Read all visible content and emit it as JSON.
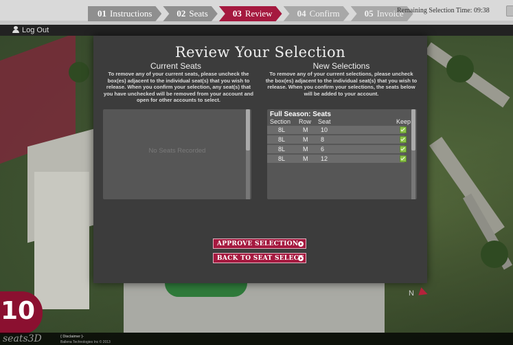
{
  "steps": [
    {
      "num": "01",
      "label": "Instructions",
      "state": "done"
    },
    {
      "num": "02",
      "label": "Seats",
      "state": "done"
    },
    {
      "num": "03",
      "label": "Review",
      "state": "active"
    },
    {
      "num": "04",
      "label": "Confirm",
      "state": "todo"
    },
    {
      "num": "05",
      "label": "Invoice",
      "state": "todo"
    }
  ],
  "timer": "Remaining Selection Time: 09:38",
  "logout": "Log Out",
  "panel": {
    "title": "Review Your Selection",
    "current": {
      "heading": "Current Seats",
      "instructions": "To remove any of your current seats, please uncheck the box(es) adjacent to the individual seat(s) that you wish to release. When you confirm your selection, any seat(s) that you have unchecked will be removed from your account and open for other accounts to select.",
      "empty": "No Seats Recorded"
    },
    "new": {
      "heading": "New Selections",
      "instructions": "To remove any of your current selections, please uncheck the box(es) adjacent to the individual seat(s) that you wish to release. When you confirm your selections, the seats below will be added to your account.",
      "group": "Full Season: Seats",
      "columns": [
        "Section",
        "Row",
        "Seat",
        "Keep"
      ],
      "rows": [
        {
          "section": "8L",
          "row": "M",
          "seat": "10",
          "keep": true
        },
        {
          "section": "8L",
          "row": "M",
          "seat": "8",
          "keep": true
        },
        {
          "section": "8L",
          "row": "M",
          "seat": "6",
          "keep": true
        },
        {
          "section": "8L",
          "row": "M",
          "seat": "12",
          "keep": true
        }
      ]
    },
    "approve": "APPROVE SELECTION",
    "back": "BACK TO SEAT SELECT"
  },
  "badge": "10",
  "logo": "seats3D",
  "disclaimer": "{ Disclaimer }-",
  "copyright": "Ballena Technologies Inc © 2013",
  "compass": "N",
  "colors": {
    "accent": "#a5193f",
    "panel": "#3c3c3c",
    "check": "#8cc24a"
  }
}
